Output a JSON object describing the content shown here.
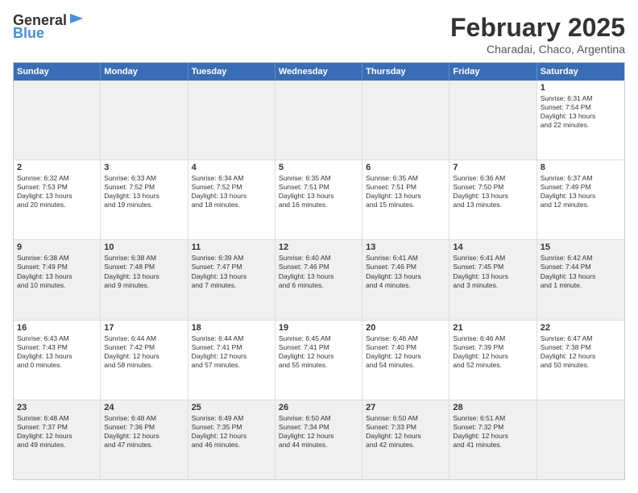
{
  "header": {
    "logo_line1": "General",
    "logo_line2": "Blue",
    "month": "February 2025",
    "location": "Charadai, Chaco, Argentina"
  },
  "weekdays": [
    "Sunday",
    "Monday",
    "Tuesday",
    "Wednesday",
    "Thursday",
    "Friday",
    "Saturday"
  ],
  "rows": [
    [
      {
        "day": "",
        "text": "",
        "shaded": true
      },
      {
        "day": "",
        "text": "",
        "shaded": true
      },
      {
        "day": "",
        "text": "",
        "shaded": true
      },
      {
        "day": "",
        "text": "",
        "shaded": true
      },
      {
        "day": "",
        "text": "",
        "shaded": true
      },
      {
        "day": "",
        "text": "",
        "shaded": true
      },
      {
        "day": "1",
        "text": "Sunrise: 6:31 AM\nSunset: 7:54 PM\nDaylight: 13 hours\nand 22 minutes.",
        "shaded": false
      }
    ],
    [
      {
        "day": "2",
        "text": "Sunrise: 6:32 AM\nSunset: 7:53 PM\nDaylight: 13 hours\nand 20 minutes.",
        "shaded": false
      },
      {
        "day": "3",
        "text": "Sunrise: 6:33 AM\nSunset: 7:52 PM\nDaylight: 13 hours\nand 19 minutes.",
        "shaded": false
      },
      {
        "day": "4",
        "text": "Sunrise: 6:34 AM\nSunset: 7:52 PM\nDaylight: 13 hours\nand 18 minutes.",
        "shaded": false
      },
      {
        "day": "5",
        "text": "Sunrise: 6:35 AM\nSunset: 7:51 PM\nDaylight: 13 hours\nand 16 minutes.",
        "shaded": false
      },
      {
        "day": "6",
        "text": "Sunrise: 6:35 AM\nSunset: 7:51 PM\nDaylight: 13 hours\nand 15 minutes.",
        "shaded": false
      },
      {
        "day": "7",
        "text": "Sunrise: 6:36 AM\nSunset: 7:50 PM\nDaylight: 13 hours\nand 13 minutes.",
        "shaded": false
      },
      {
        "day": "8",
        "text": "Sunrise: 6:37 AM\nSunset: 7:49 PM\nDaylight: 13 hours\nand 12 minutes.",
        "shaded": false
      }
    ],
    [
      {
        "day": "9",
        "text": "Sunrise: 6:38 AM\nSunset: 7:49 PM\nDaylight: 13 hours\nand 10 minutes.",
        "shaded": true
      },
      {
        "day": "10",
        "text": "Sunrise: 6:38 AM\nSunset: 7:48 PM\nDaylight: 13 hours\nand 9 minutes.",
        "shaded": true
      },
      {
        "day": "11",
        "text": "Sunrise: 6:39 AM\nSunset: 7:47 PM\nDaylight: 13 hours\nand 7 minutes.",
        "shaded": true
      },
      {
        "day": "12",
        "text": "Sunrise: 6:40 AM\nSunset: 7:46 PM\nDaylight: 13 hours\nand 6 minutes.",
        "shaded": true
      },
      {
        "day": "13",
        "text": "Sunrise: 6:41 AM\nSunset: 7:46 PM\nDaylight: 13 hours\nand 4 minutes.",
        "shaded": true
      },
      {
        "day": "14",
        "text": "Sunrise: 6:41 AM\nSunset: 7:45 PM\nDaylight: 13 hours\nand 3 minutes.",
        "shaded": true
      },
      {
        "day": "15",
        "text": "Sunrise: 6:42 AM\nSunset: 7:44 PM\nDaylight: 13 hours\nand 1 minute.",
        "shaded": true
      }
    ],
    [
      {
        "day": "16",
        "text": "Sunrise: 6:43 AM\nSunset: 7:43 PM\nDaylight: 13 hours\nand 0 minutes.",
        "shaded": false
      },
      {
        "day": "17",
        "text": "Sunrise: 6:44 AM\nSunset: 7:42 PM\nDaylight: 12 hours\nand 58 minutes.",
        "shaded": false
      },
      {
        "day": "18",
        "text": "Sunrise: 6:44 AM\nSunset: 7:41 PM\nDaylight: 12 hours\nand 57 minutes.",
        "shaded": false
      },
      {
        "day": "19",
        "text": "Sunrise: 6:45 AM\nSunset: 7:41 PM\nDaylight: 12 hours\nand 55 minutes.",
        "shaded": false
      },
      {
        "day": "20",
        "text": "Sunrise: 6:46 AM\nSunset: 7:40 PM\nDaylight: 12 hours\nand 54 minutes.",
        "shaded": false
      },
      {
        "day": "21",
        "text": "Sunrise: 6:46 AM\nSunset: 7:39 PM\nDaylight: 12 hours\nand 52 minutes.",
        "shaded": false
      },
      {
        "day": "22",
        "text": "Sunrise: 6:47 AM\nSunset: 7:38 PM\nDaylight: 12 hours\nand 50 minutes.",
        "shaded": false
      }
    ],
    [
      {
        "day": "23",
        "text": "Sunrise: 6:48 AM\nSunset: 7:37 PM\nDaylight: 12 hours\nand 49 minutes.",
        "shaded": true
      },
      {
        "day": "24",
        "text": "Sunrise: 6:48 AM\nSunset: 7:36 PM\nDaylight: 12 hours\nand 47 minutes.",
        "shaded": true
      },
      {
        "day": "25",
        "text": "Sunrise: 6:49 AM\nSunset: 7:35 PM\nDaylight: 12 hours\nand 46 minutes.",
        "shaded": true
      },
      {
        "day": "26",
        "text": "Sunrise: 6:50 AM\nSunset: 7:34 PM\nDaylight: 12 hours\nand 44 minutes.",
        "shaded": true
      },
      {
        "day": "27",
        "text": "Sunrise: 6:50 AM\nSunset: 7:33 PM\nDaylight: 12 hours\nand 42 minutes.",
        "shaded": true
      },
      {
        "day": "28",
        "text": "Sunrise: 6:51 AM\nSunset: 7:32 PM\nDaylight: 12 hours\nand 41 minutes.",
        "shaded": true
      },
      {
        "day": "",
        "text": "",
        "shaded": true
      }
    ]
  ]
}
